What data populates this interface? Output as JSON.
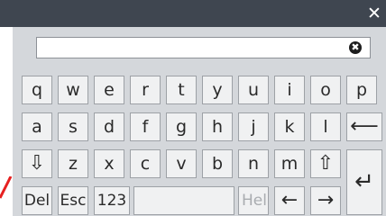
{
  "title_bar": {
    "close_label": "✕"
  },
  "input": {
    "value": "",
    "clear_label": "✖"
  },
  "keys": {
    "row1": [
      "q",
      "w",
      "e",
      "r",
      "t",
      "y",
      "u",
      "i",
      "o",
      "p"
    ],
    "row2": [
      "a",
      "s",
      "d",
      "f",
      "g",
      "h",
      "j",
      "k",
      "l"
    ],
    "backspace": "⟵",
    "shift_down": "⇩",
    "row3": [
      "z",
      "x",
      "c",
      "v",
      "b",
      "n",
      "m"
    ],
    "shift_up": "⇧",
    "enter": "↵",
    "del": "Del",
    "esc": "Esc",
    "num": "123",
    "space": "",
    "help": "Help",
    "left": "←",
    "right": "→"
  }
}
